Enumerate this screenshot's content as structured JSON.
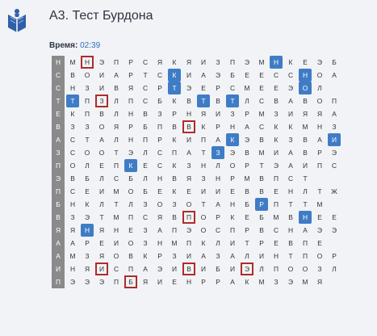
{
  "header": {
    "title": "A3. Тест Бурдона"
  },
  "timer": {
    "label": "Время:",
    "value": "02:39"
  },
  "rows": [
    {
      "letters": "НМНЭПРСЯКЯИЗПЭМНКЕЭБ",
      "blue": [
        15
      ],
      "red": [
        2
      ]
    },
    {
      "letters": "СВОИАРТСКИАЭБЕЕССНОА",
      "blue": [
        8,
        17
      ],
      "red": []
    },
    {
      "letters": "СНЗИВЯСРТЭЕРСМЕЕЭОЛ",
      "blue": [
        8,
        17
      ],
      "red": []
    },
    {
      "letters": "ТТПЗЛПСБКВТВТЛСВАВОП",
      "blue": [
        1,
        10,
        12
      ],
      "red": [
        3
      ]
    },
    {
      "letters": "ЕКПВЛНВЗРНЯИЗРМЗИЯЯА",
      "blue": [],
      "red": []
    },
    {
      "letters": "ВЗЗОЯРБПВВКРНАСККМНЗ",
      "blue": [],
      "red": [
        9
      ]
    },
    {
      "letters": "АСТАЛНПРКИПАКЭВКЗВАИ",
      "blue": [
        12,
        19
      ],
      "red": []
    },
    {
      "letters": "ЗСООТЭЛСПАТЗЭВМИАВРЭ",
      "blue": [
        11
      ],
      "red": []
    },
    {
      "letters": "ПОЛЕПКЕСКЗНЛОРТЭАИПС",
      "blue": [
        5
      ],
      "red": []
    },
    {
      "letters": "ЭВБЛСБЛНВЯЗНРМВПСТ",
      "blue": [],
      "red": []
    },
    {
      "letters": "ПСЕИМОБЕКЕИИЕВВЕНЛТЖ",
      "blue": [],
      "red": []
    },
    {
      "letters": "БНКЛТЛЗОЗОТАНБРПТТМ",
      "blue": [
        14
      ],
      "red": []
    },
    {
      "letters": "ВЗЭТМПСЯВПОРКЕБМВНЕЕ",
      "blue": [
        17
      ],
      "red": [
        9
      ]
    },
    {
      "letters": "ЯЯНЯНЕЗАПЭОСПРВСНАЭЭ",
      "blue": [
        2
      ],
      "red": []
    },
    {
      "letters": "ААРЕИОЗНМПКЛИТРЕВПЕ",
      "blue": [],
      "red": []
    },
    {
      "letters": "АМЗЯОВКРЗИАЗАЛИНТПОР",
      "blue": [],
      "red": []
    },
    {
      "letters": "ИНЯИСПАЭИВИБИЭЛПООЗЛ",
      "blue": [],
      "red": [
        3,
        9,
        13
      ]
    },
    {
      "letters": "ПЭЭЭПБЯИЕНРРАКМЗЭМЯ",
      "blue": [],
      "red": [
        5
      ]
    }
  ]
}
